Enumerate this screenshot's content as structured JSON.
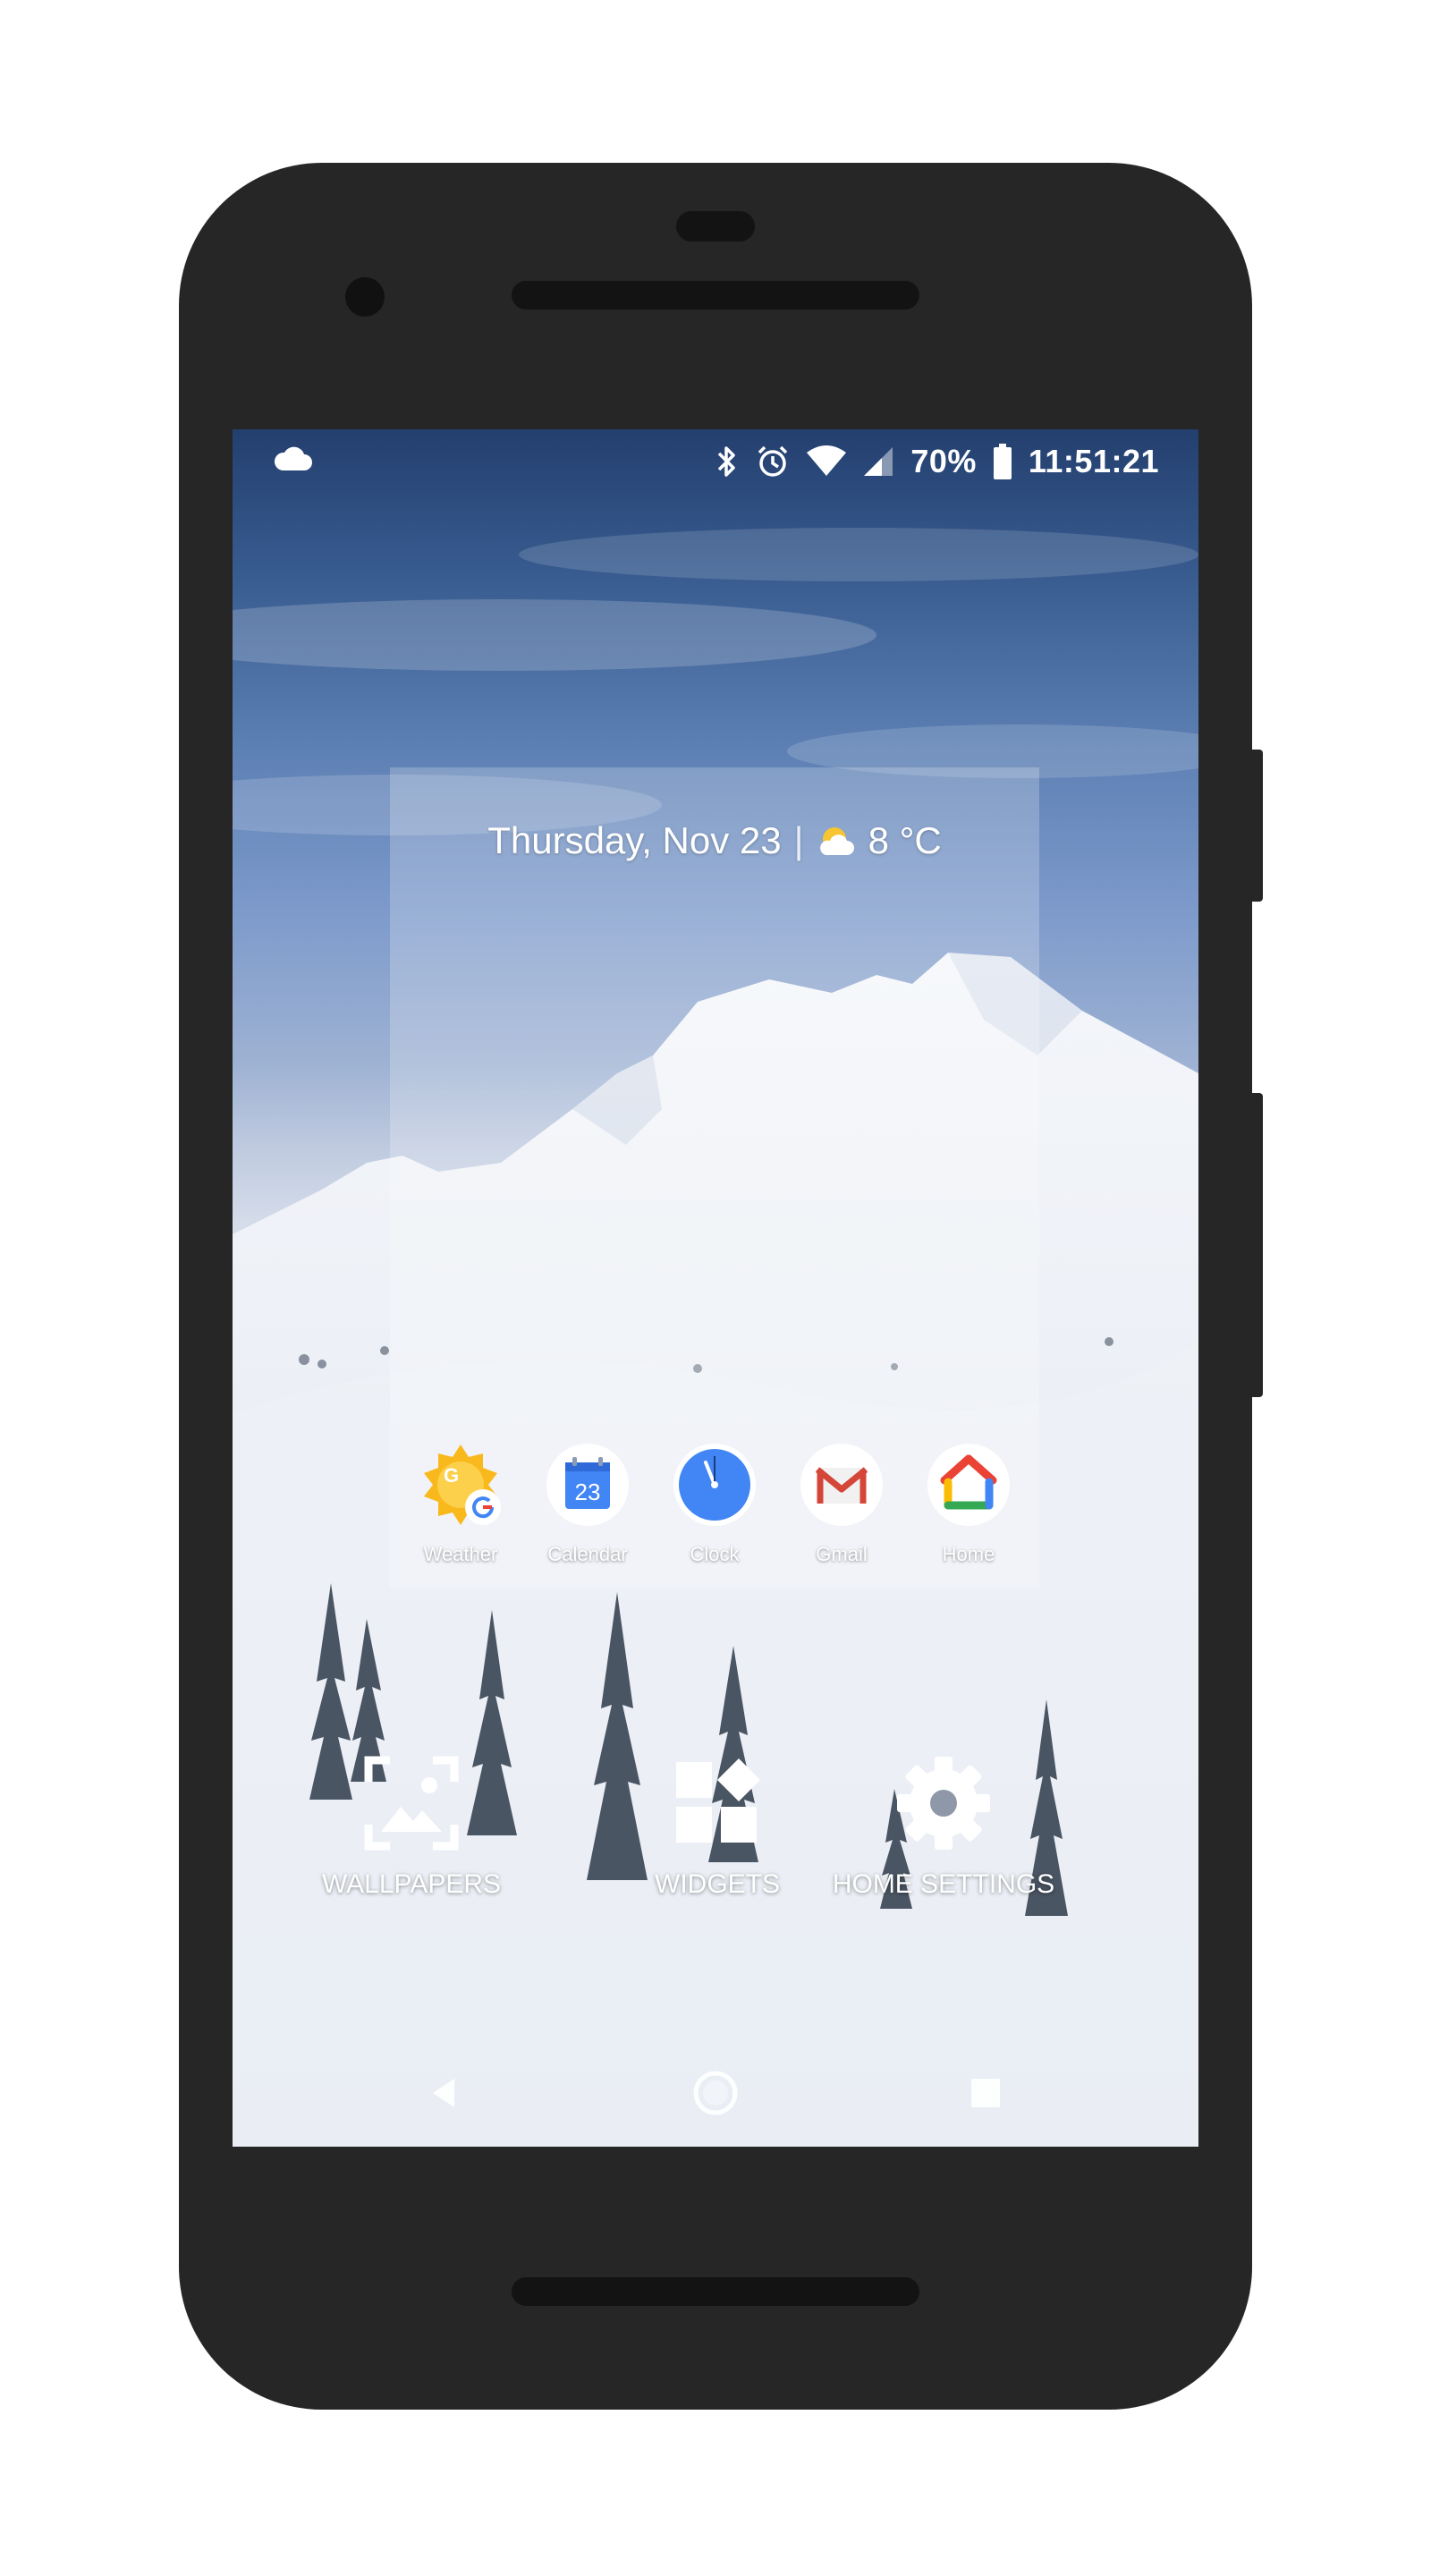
{
  "status_bar": {
    "battery_percent": "70%",
    "time": "11:51:21",
    "icons": [
      "cloud-icon",
      "bluetooth-icon",
      "alarm-icon",
      "wifi-icon",
      "signal-icon",
      "battery-icon"
    ]
  },
  "widget": {
    "date": "Thursday, Nov 23",
    "separator": "|",
    "temperature": "8 °C",
    "weather_icon": "partly-cloudy-icon"
  },
  "apps": [
    {
      "label": "Weather",
      "icon": "weather-app-icon"
    },
    {
      "label": "Calendar",
      "icon": "calendar-app-icon",
      "day": "23"
    },
    {
      "label": "Clock",
      "icon": "clock-app-icon"
    },
    {
      "label": "Gmail",
      "icon": "gmail-app-icon"
    },
    {
      "label": "Home",
      "icon": "home-app-icon"
    }
  ],
  "options": [
    {
      "label": "WALLPAPERS",
      "icon": "wallpaper-icon"
    },
    {
      "label": "WIDGETS",
      "icon": "widgets-icon"
    },
    {
      "label": "HOME SETTINGS",
      "icon": "gear-icon"
    }
  ],
  "nav": {
    "icons": [
      "back-icon",
      "home-icon",
      "recents-icon"
    ]
  },
  "colors": {
    "phone_body": "#262626",
    "sky_top": "#233f6e",
    "snow": "#e9edf4",
    "google_blue": "#4285f4",
    "google_red": "#ea4335",
    "google_yellow": "#fbbc05",
    "google_green": "#34a853"
  }
}
